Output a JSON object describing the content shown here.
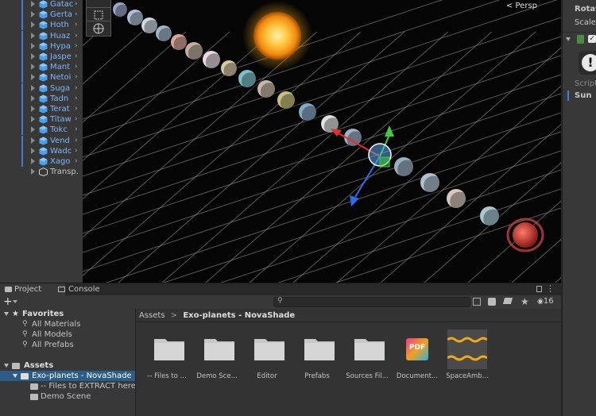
{
  "hierarchy": {
    "items": [
      {
        "label": "Gatac"
      },
      {
        "label": "Gerta"
      },
      {
        "label": "Hoth"
      },
      {
        "label": "Huaz"
      },
      {
        "label": "Hypa"
      },
      {
        "label": "Jaspe"
      },
      {
        "label": "Mant"
      },
      {
        "label": "Netoi"
      },
      {
        "label": "Suga"
      },
      {
        "label": "Tadn"
      },
      {
        "label": "Terat"
      },
      {
        "label": "Titaw"
      },
      {
        "label": "Tokc"
      },
      {
        "label": "Vend"
      },
      {
        "label": "Wadc"
      },
      {
        "label": "Xago"
      }
    ],
    "last_item": "Transp."
  },
  "scene": {
    "projection_label": "< Persp"
  },
  "inspector": {
    "rotation_label": "Rotat",
    "scale_label": "Scale",
    "script_label": "Script",
    "object_label": "Sun"
  },
  "tabs": {
    "project": "Project",
    "console": "Console"
  },
  "toolbar": {
    "add_label": "+",
    "hidden_count": "16"
  },
  "favorites": {
    "header": "Favorites",
    "items": [
      "All Materials",
      "All Models",
      "All Prefabs"
    ]
  },
  "assets_tree": {
    "header": "Assets",
    "selected": "Exo-planets - NovaShade",
    "children": [
      "-- Files to EXTRACT here",
      "Demo Scene"
    ]
  },
  "breadcrumb": {
    "root": "Assets",
    "separator": ">",
    "current": "Exo-planets - NovaShade"
  },
  "assets": [
    {
      "label": "-- Files to ...",
      "kind": "folder"
    },
    {
      "label": "Demo Sce...",
      "kind": "folder"
    },
    {
      "label": "Editor",
      "kind": "folder"
    },
    {
      "label": "Prefabs",
      "kind": "folder"
    },
    {
      "label": "Sources Fil...",
      "kind": "folder"
    },
    {
      "label": "Document...",
      "kind": "pdf",
      "badge": "PDF"
    },
    {
      "label": "SpaceAmb...",
      "kind": "audio"
    }
  ],
  "colors": {
    "accent": "#3b7fd6",
    "hierarchy_text": "#7fb6ff",
    "panel": "#383838",
    "scene_bg": "#050505",
    "gizmo_x": "#e0302a",
    "gizmo_y": "#3ad03a",
    "gizmo_z": "#2a6cf0",
    "sun": "#ffb020",
    "audio_wave": "#f0a818"
  }
}
